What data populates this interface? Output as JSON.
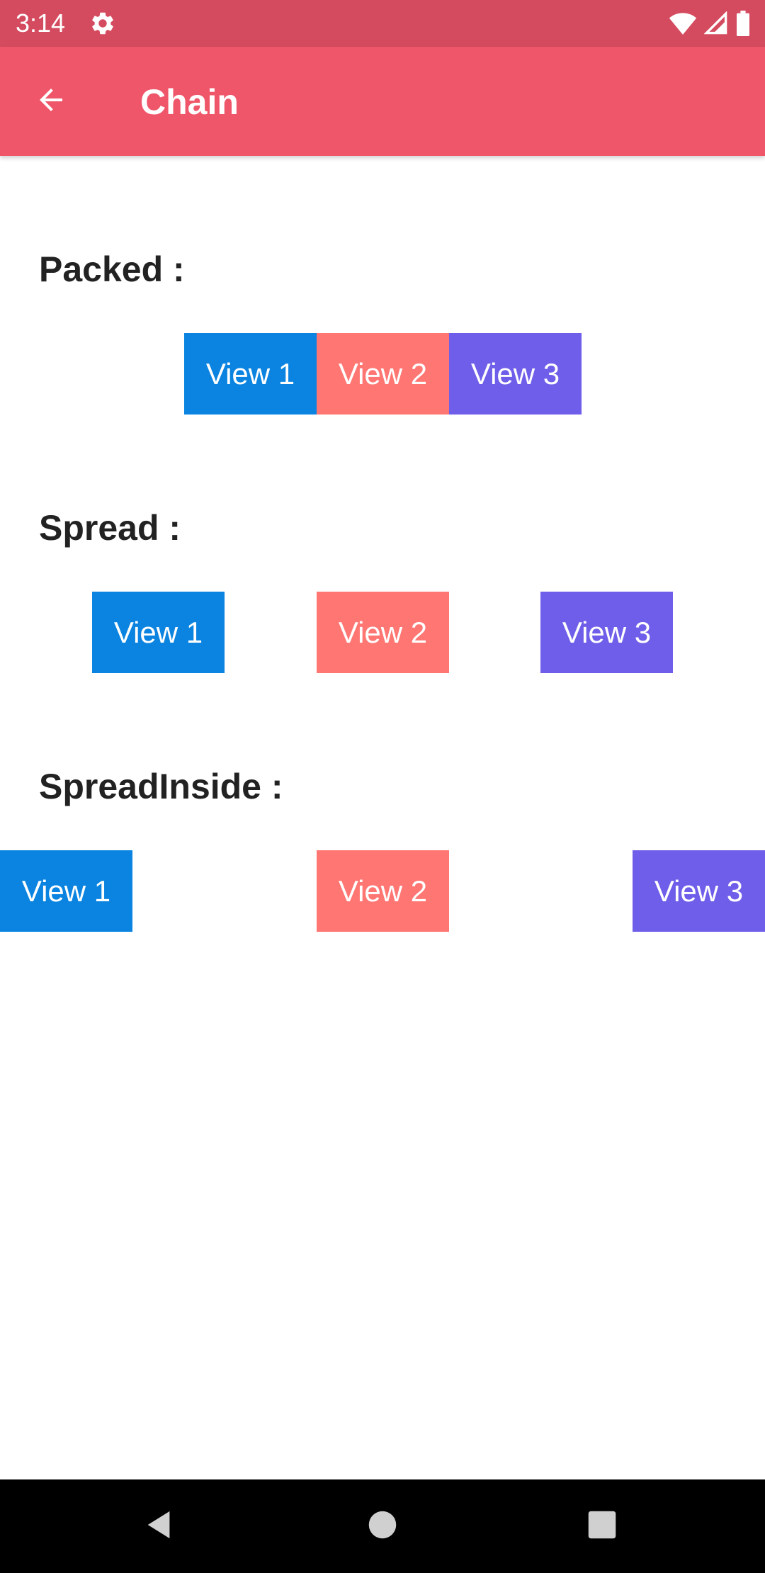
{
  "status_bar": {
    "time": "3:14",
    "icons": [
      "gear-icon",
      "wifi-icon",
      "signal-icon",
      "battery-icon"
    ],
    "background": "#d44b5f"
  },
  "app_bar": {
    "title": "Chain",
    "back_icon": "arrow-back-icon",
    "background": "#ef5669"
  },
  "sections": [
    {
      "label": "Packed :",
      "views": [
        "View 1",
        "View 2",
        "View 3"
      ]
    },
    {
      "label": "Spread :",
      "views": [
        "View 1",
        "View 2",
        "View 3"
      ]
    },
    {
      "label": "SpreadInside :",
      "views": [
        "View 1",
        "View 2",
        "View 3"
      ]
    }
  ],
  "colors": {
    "view1": "#0a84e0",
    "view2": "#ff7673",
    "view3": "#6f5ee9",
    "label_text": "#222222"
  },
  "nav_bar": {
    "icons": [
      "nav-back-icon",
      "nav-home-icon",
      "nav-recents-icon"
    ]
  }
}
